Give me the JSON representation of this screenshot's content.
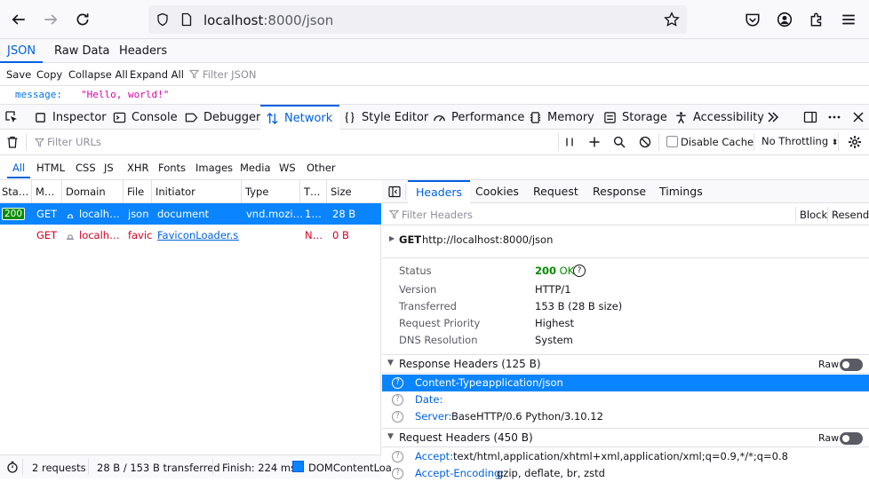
{
  "browser": {
    "url_host": "localhost",
    "url_rest": ":8000/json"
  },
  "viewer_tabs": [
    "JSON",
    "Raw Data",
    "Headers"
  ],
  "json_toolbar": {
    "save": "Save",
    "copy": "Copy",
    "collapse_all": "Collapse All",
    "expand_all": "Expand All",
    "filter_placeholder": "Filter JSON"
  },
  "json_content": {
    "key": "message:",
    "value": "\"Hello, world!\""
  },
  "devtools_tabs": [
    "Inspector",
    "Console",
    "Debugger",
    "Network",
    "Style Editor",
    "Performance",
    "Memory",
    "Storage",
    "Accessibility"
  ],
  "network_toolbar": {
    "filter_placeholder": "Filter URLs",
    "disable_cache": "Disable Cache",
    "throttling": "No Throttling"
  },
  "filter_types": [
    "All",
    "HTML",
    "CSS",
    "JS",
    "XHR",
    "Fonts",
    "Images",
    "Media",
    "WS",
    "Other"
  ],
  "columns": [
    "Sta…",
    "M…",
    "Domain",
    "File",
    "Initiator",
    "Type",
    "T…",
    "Size"
  ],
  "requests": [
    {
      "status": "200",
      "method": "GET",
      "domain": "localh…",
      "file": "json",
      "initiator": "document",
      "type": "vnd.mozi…",
      "transferred": "1…",
      "size": "28 B"
    },
    {
      "status": "",
      "method": "GET",
      "domain": "localh…",
      "file": "favicc",
      "initiator": "FaviconLoader.s…",
      "type": "",
      "transferred": "N…",
      "size": "0 B"
    }
  ],
  "statusbar": {
    "requests": "2 requests",
    "transferred": "28 B / 153 B transferred",
    "finish": "Finish: 224 ms",
    "dcl": "DOMContentLoa"
  },
  "side_tabs": [
    "Headers",
    "Cookies",
    "Request",
    "Response",
    "Timings"
  ],
  "headers_panel": {
    "filter_placeholder": "Filter Headers",
    "block": "Block",
    "resend": "Resend",
    "request_line_method": "GET",
    "request_line_url": "http://localhost:8000/json",
    "summary": [
      {
        "label": "Status",
        "value": "200",
        "value2": "OK"
      },
      {
        "label": "Version",
        "value": "HTTP/1"
      },
      {
        "label": "Transferred",
        "value": "153 B (28 B size)"
      },
      {
        "label": "Request Priority",
        "value": "Highest"
      },
      {
        "label": "DNS Resolution",
        "value": "System"
      }
    ],
    "response_headers_title": "Response Headers (125 B)",
    "request_headers_title": "Request Headers (450 B)",
    "raw": "Raw",
    "response_headers": [
      {
        "name": "Content-Type:",
        "value": "application/json"
      },
      {
        "name": "Date:",
        "value": ""
      },
      {
        "name": "Server:",
        "value": "BaseHTTP/0.6 Python/3.10.12"
      }
    ],
    "request_headers": [
      {
        "name": "Accept:",
        "value": "text/html,application/xhtml+xml,application/xml;q=0.9,*/*;q=0.8"
      },
      {
        "name": "Accept-Encoding:",
        "value": "gzip, deflate, br, zstd"
      }
    ]
  },
  "colors": {
    "accent": "#0061e0",
    "selected_row": "#0a84ff",
    "status_ok": "#058b00",
    "error": "#d70022"
  }
}
